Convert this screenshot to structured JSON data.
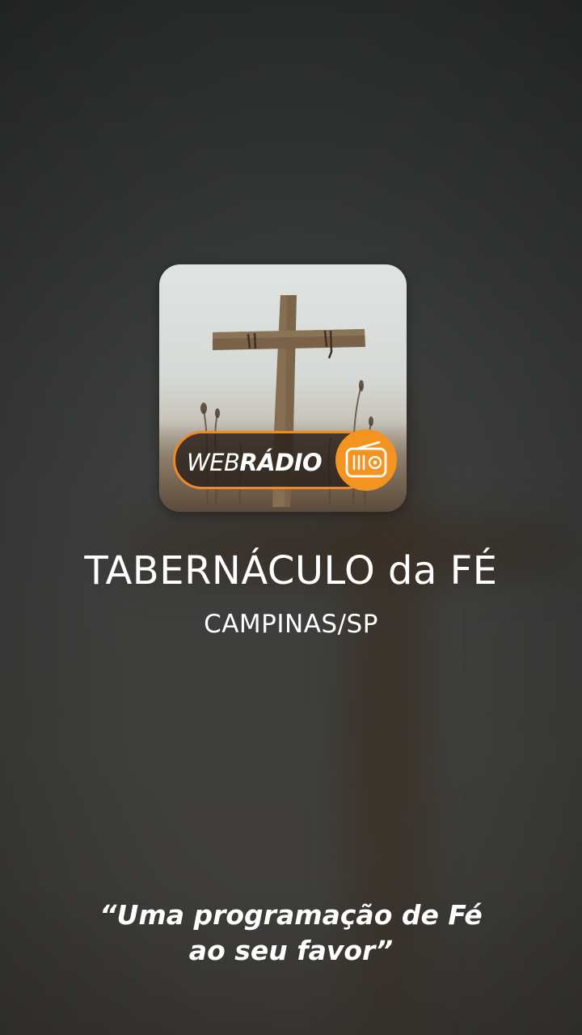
{
  "app": {
    "icon_name": "cross-radio-logo-icon",
    "badge": {
      "web": "WEB",
      "radio": "RÁDIO"
    },
    "title": "TABERNÁCULO da FÉ",
    "subtitle": "CAMPINAS/SP",
    "slogan_line1": "“Uma programação de Fé",
    "slogan_line2": "ao seu favor”"
  },
  "colors": {
    "accent": "#f39320",
    "background": "#3a3c3b",
    "text": "#ffffff"
  }
}
